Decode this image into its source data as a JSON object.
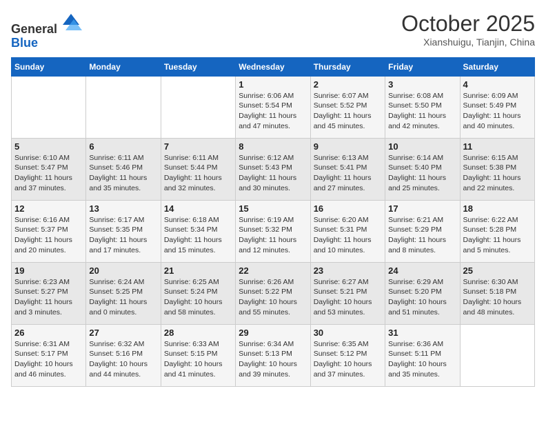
{
  "header": {
    "logo_line1": "General",
    "logo_line2": "Blue",
    "month": "October 2025",
    "location": "Xianshuigu, Tianjin, China"
  },
  "days_of_week": [
    "Sunday",
    "Monday",
    "Tuesday",
    "Wednesday",
    "Thursday",
    "Friday",
    "Saturday"
  ],
  "weeks": [
    [
      {
        "day": "",
        "info": ""
      },
      {
        "day": "",
        "info": ""
      },
      {
        "day": "",
        "info": ""
      },
      {
        "day": "1",
        "info": "Sunrise: 6:06 AM\nSunset: 5:54 PM\nDaylight: 11 hours and 47 minutes."
      },
      {
        "day": "2",
        "info": "Sunrise: 6:07 AM\nSunset: 5:52 PM\nDaylight: 11 hours and 45 minutes."
      },
      {
        "day": "3",
        "info": "Sunrise: 6:08 AM\nSunset: 5:50 PM\nDaylight: 11 hours and 42 minutes."
      },
      {
        "day": "4",
        "info": "Sunrise: 6:09 AM\nSunset: 5:49 PM\nDaylight: 11 hours and 40 minutes."
      }
    ],
    [
      {
        "day": "5",
        "info": "Sunrise: 6:10 AM\nSunset: 5:47 PM\nDaylight: 11 hours and 37 minutes."
      },
      {
        "day": "6",
        "info": "Sunrise: 6:11 AM\nSunset: 5:46 PM\nDaylight: 11 hours and 35 minutes."
      },
      {
        "day": "7",
        "info": "Sunrise: 6:11 AM\nSunset: 5:44 PM\nDaylight: 11 hours and 32 minutes."
      },
      {
        "day": "8",
        "info": "Sunrise: 6:12 AM\nSunset: 5:43 PM\nDaylight: 11 hours and 30 minutes."
      },
      {
        "day": "9",
        "info": "Sunrise: 6:13 AM\nSunset: 5:41 PM\nDaylight: 11 hours and 27 minutes."
      },
      {
        "day": "10",
        "info": "Sunrise: 6:14 AM\nSunset: 5:40 PM\nDaylight: 11 hours and 25 minutes."
      },
      {
        "day": "11",
        "info": "Sunrise: 6:15 AM\nSunset: 5:38 PM\nDaylight: 11 hours and 22 minutes."
      }
    ],
    [
      {
        "day": "12",
        "info": "Sunrise: 6:16 AM\nSunset: 5:37 PM\nDaylight: 11 hours and 20 minutes."
      },
      {
        "day": "13",
        "info": "Sunrise: 6:17 AM\nSunset: 5:35 PM\nDaylight: 11 hours and 17 minutes."
      },
      {
        "day": "14",
        "info": "Sunrise: 6:18 AM\nSunset: 5:34 PM\nDaylight: 11 hours and 15 minutes."
      },
      {
        "day": "15",
        "info": "Sunrise: 6:19 AM\nSunset: 5:32 PM\nDaylight: 11 hours and 12 minutes."
      },
      {
        "day": "16",
        "info": "Sunrise: 6:20 AM\nSunset: 5:31 PM\nDaylight: 11 hours and 10 minutes."
      },
      {
        "day": "17",
        "info": "Sunrise: 6:21 AM\nSunset: 5:29 PM\nDaylight: 11 hours and 8 minutes."
      },
      {
        "day": "18",
        "info": "Sunrise: 6:22 AM\nSunset: 5:28 PM\nDaylight: 11 hours and 5 minutes."
      }
    ],
    [
      {
        "day": "19",
        "info": "Sunrise: 6:23 AM\nSunset: 5:27 PM\nDaylight: 11 hours and 3 minutes."
      },
      {
        "day": "20",
        "info": "Sunrise: 6:24 AM\nSunset: 5:25 PM\nDaylight: 11 hours and 0 minutes."
      },
      {
        "day": "21",
        "info": "Sunrise: 6:25 AM\nSunset: 5:24 PM\nDaylight: 10 hours and 58 minutes."
      },
      {
        "day": "22",
        "info": "Sunrise: 6:26 AM\nSunset: 5:22 PM\nDaylight: 10 hours and 55 minutes."
      },
      {
        "day": "23",
        "info": "Sunrise: 6:27 AM\nSunset: 5:21 PM\nDaylight: 10 hours and 53 minutes."
      },
      {
        "day": "24",
        "info": "Sunrise: 6:29 AM\nSunset: 5:20 PM\nDaylight: 10 hours and 51 minutes."
      },
      {
        "day": "25",
        "info": "Sunrise: 6:30 AM\nSunset: 5:18 PM\nDaylight: 10 hours and 48 minutes."
      }
    ],
    [
      {
        "day": "26",
        "info": "Sunrise: 6:31 AM\nSunset: 5:17 PM\nDaylight: 10 hours and 46 minutes."
      },
      {
        "day": "27",
        "info": "Sunrise: 6:32 AM\nSunset: 5:16 PM\nDaylight: 10 hours and 44 minutes."
      },
      {
        "day": "28",
        "info": "Sunrise: 6:33 AM\nSunset: 5:15 PM\nDaylight: 10 hours and 41 minutes."
      },
      {
        "day": "29",
        "info": "Sunrise: 6:34 AM\nSunset: 5:13 PM\nDaylight: 10 hours and 39 minutes."
      },
      {
        "day": "30",
        "info": "Sunrise: 6:35 AM\nSunset: 5:12 PM\nDaylight: 10 hours and 37 minutes."
      },
      {
        "day": "31",
        "info": "Sunrise: 6:36 AM\nSunset: 5:11 PM\nDaylight: 10 hours and 35 minutes."
      },
      {
        "day": "",
        "info": ""
      }
    ]
  ]
}
